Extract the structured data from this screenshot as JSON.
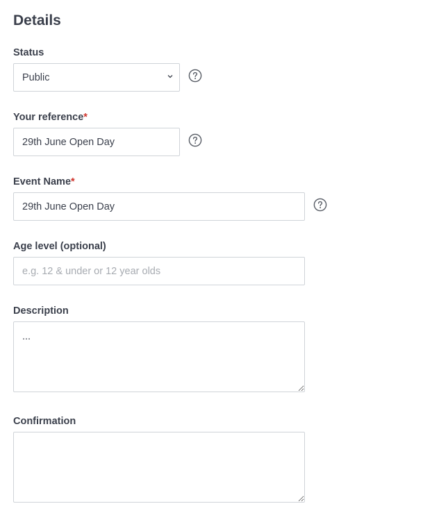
{
  "details": {
    "title": "Details"
  },
  "status": {
    "label": "Status",
    "value": "Public",
    "help_icon": "help-circle-icon"
  },
  "your_reference": {
    "label": "Your reference",
    "required_mark": "*",
    "value": "29th June Open Day",
    "help_icon": "help-circle-icon"
  },
  "event_name": {
    "label": "Event Name",
    "required_mark": "*",
    "value": "29th June Open Day",
    "help_icon": "help-circle-icon"
  },
  "age_level": {
    "label": "Age level (optional)",
    "value": "",
    "placeholder": "e.g. 12 & under or 12 year olds"
  },
  "description": {
    "label": "Description",
    "value": "..."
  },
  "confirmation": {
    "label": "Confirmation",
    "value": ""
  },
  "colors": {
    "required": "#d0342c",
    "border": "#cfd3d8",
    "text": "#3a3f4b",
    "placeholder": "#a7abb1"
  }
}
